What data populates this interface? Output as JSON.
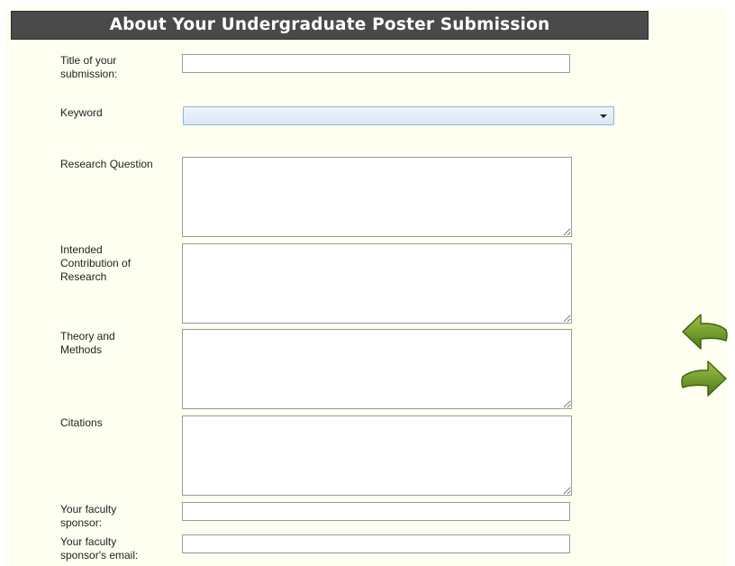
{
  "form": {
    "title": "About Your Undergraduate Poster Submission",
    "fields": {
      "title": {
        "label": "Title of your submission:",
        "value": ""
      },
      "keyword": {
        "label": "Keyword",
        "selected": ""
      },
      "research_question": {
        "label": "Research Question",
        "value": ""
      },
      "intended_contribution": {
        "label": "Intended Contribution of Research",
        "value": ""
      },
      "theory_methods": {
        "label": "Theory and Methods",
        "value": ""
      },
      "citations": {
        "label": "Citations",
        "value": ""
      },
      "faculty_sponsor": {
        "label": "Your faculty sponsor:",
        "value": ""
      },
      "faculty_email": {
        "label": "Your faculty sponsor's email:",
        "value": ""
      }
    }
  },
  "nav": {
    "back_icon": "arrow-left-icon",
    "next_icon": "arrow-right-icon",
    "arrow_color": "#5e8c1e"
  },
  "colors": {
    "header_bg": "#4a4a4a",
    "panel_bg": "#fefff0"
  }
}
